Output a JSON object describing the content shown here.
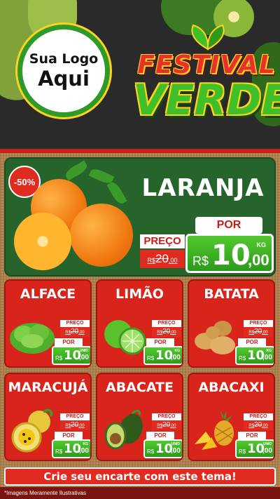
{
  "header": {
    "logo_line1": "Sua Logo",
    "logo_line2": "Aqui",
    "title_line1": "FESTIVAL",
    "title_line2": "VERDE"
  },
  "featured": {
    "discount": "-50%",
    "name": "LARANJA",
    "preco_label": "PREÇO",
    "old_currency": "R$",
    "old_int": "20",
    "old_cents": ",00",
    "por_label": "POR",
    "currency": "R$",
    "price_int": "10",
    "price_cents": ",00",
    "unit": "KG"
  },
  "products": [
    {
      "name": "ALFACE",
      "preco_label": "PREÇO",
      "old_currency": "R$",
      "old_int": "20",
      "old_cents": ",00",
      "por_label": "POR",
      "currency": "R$",
      "price_int": "10",
      "price_cents": ",00",
      "unit": "UNID"
    },
    {
      "name": "LIMÃO",
      "preco_label": "PREÇO",
      "old_currency": "R$",
      "old_int": "20",
      "old_cents": ",00",
      "por_label": "POR",
      "currency": "R$",
      "price_int": "10",
      "price_cents": ",00",
      "unit": "KG"
    },
    {
      "name": "BATATA",
      "preco_label": "PREÇO",
      "old_currency": "R$",
      "old_int": "20",
      "old_cents": ",00",
      "por_label": "POR",
      "currency": "R$",
      "price_int": "10",
      "price_cents": ",00",
      "unit": "KG"
    },
    {
      "name": "MARACUJÁ",
      "preco_label": "PREÇO",
      "old_currency": "R$",
      "old_int": "20",
      "old_cents": ",00",
      "por_label": "POR",
      "currency": "R$",
      "price_int": "10",
      "price_cents": ",00",
      "unit": "KG"
    },
    {
      "name": "ABACATE",
      "preco_label": "PREÇO",
      "old_currency": "R$",
      "old_int": "20",
      "old_cents": ",00",
      "por_label": "POR",
      "currency": "R$",
      "price_int": "10",
      "price_cents": ",00",
      "unit": "UNID"
    },
    {
      "name": "ABACAXI",
      "preco_label": "PREÇO",
      "old_currency": "R$",
      "old_int": "20",
      "old_cents": ",00",
      "por_label": "POR",
      "currency": "R$",
      "price_int": "10",
      "price_cents": ",00",
      "unit": "UNID"
    }
  ],
  "cta": "Crie seu encarte com este tema!",
  "footnote": "*Imagens Meramente Ilustrativas",
  "colors": {
    "red": "#d9241c",
    "green": "#2d9a1c",
    "featured_bg": "#27642b",
    "yellow": "#ffd21e"
  },
  "icons": {
    "featured": "orange-illustration",
    "products": [
      "lettuce-illustration",
      "lime-illustration",
      "potato-illustration",
      "passion-fruit-illustration",
      "avocado-illustration",
      "pineapple-illustration"
    ]
  }
}
